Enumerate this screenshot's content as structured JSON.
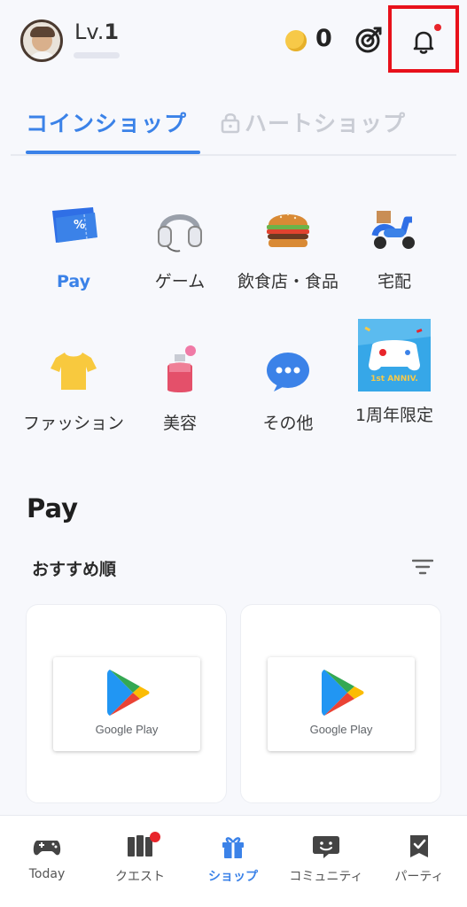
{
  "header": {
    "level_prefix": "Lv.",
    "level_value": "1",
    "coin_count": "0",
    "icons": [
      "avatar",
      "coin-icon",
      "target-icon",
      "bell-icon"
    ]
  },
  "tabs": [
    {
      "label": "コインショップ",
      "active": true
    },
    {
      "label": "ハートショップ",
      "active": false,
      "locked": true
    }
  ],
  "categories": [
    {
      "label": "Pay",
      "icon": "pay-icon"
    },
    {
      "label": "ゲーム",
      "icon": "headset-icon"
    },
    {
      "label": "飲食店・食品",
      "icon": "burger-icon"
    },
    {
      "label": "宅配",
      "icon": "scooter-icon"
    },
    {
      "label": "ファッション",
      "icon": "tshirt-icon"
    },
    {
      "label": "美容",
      "icon": "perfume-icon"
    },
    {
      "label": "その他",
      "icon": "more-icon"
    },
    {
      "label": "1周年限定",
      "icon": "anniversary-banner"
    }
  ],
  "anniversary_banner_text": "1st ANNIV.",
  "section": {
    "title": "Pay",
    "sort": "おすすめ順"
  },
  "cards": [
    {
      "brand": "Google Play"
    },
    {
      "brand": "Google Play"
    }
  ],
  "bottom_nav": [
    {
      "label": "Today",
      "icon": "gamepad-icon"
    },
    {
      "label": "クエスト",
      "icon": "map-icon"
    },
    {
      "label": "ショップ",
      "icon": "gift-icon",
      "active": true
    },
    {
      "label": "コミュニティ",
      "icon": "chat-icon"
    },
    {
      "label": "パーティ",
      "icon": "party-flag-icon"
    }
  ],
  "colors": {
    "accent": "#3b82e8",
    "notification_dot": "#e8252b",
    "highlight_box": "#e8111b",
    "background": "#f7f8fc"
  }
}
